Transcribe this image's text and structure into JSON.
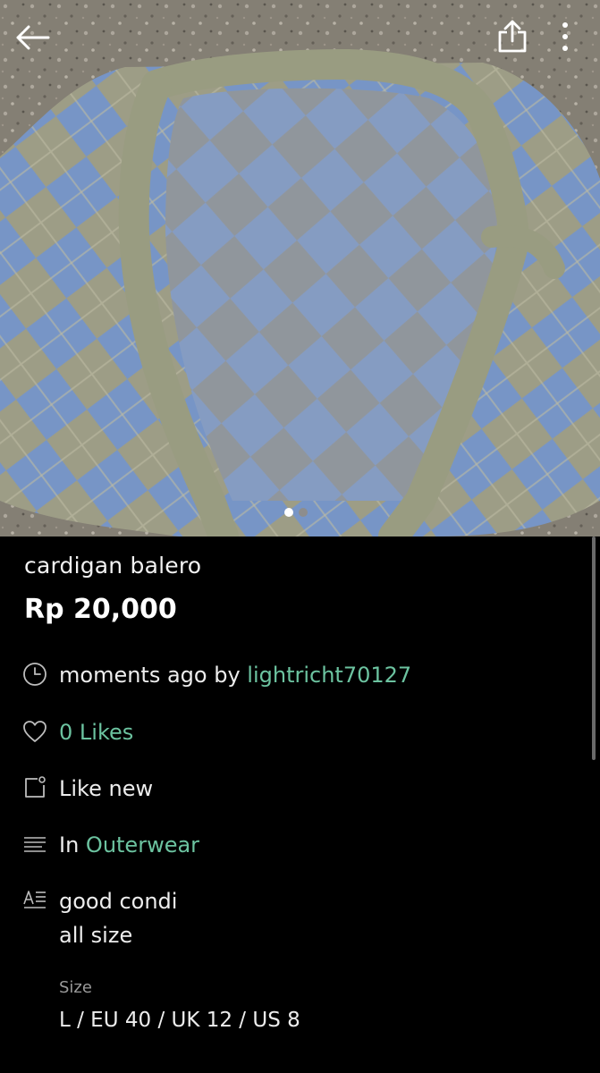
{
  "listing": {
    "title": "cardigan balero",
    "price": "Rp 20,000"
  },
  "meta": {
    "time_text": "moments ago by ",
    "seller": "lightricht70127",
    "likes": "0 Likes",
    "condition": "Like new",
    "category_prefix": "In ",
    "category": "Outerwear",
    "description_lines": [
      "good condi",
      "all size"
    ],
    "size_label": "Size",
    "size_value": "L / EU 40 / UK 12 / US 8"
  },
  "gallery": {
    "image_count": 2,
    "active_index": 0,
    "photo_subject": "cardigan-photo"
  },
  "icons": {
    "back": "arrow-left-icon",
    "share": "share-icon",
    "more": "more-vertical-icon",
    "time": "clock-icon",
    "likes": "heart-icon",
    "condition": "tag-icon",
    "category": "list-icon",
    "description": "text-icon"
  },
  "colors": {
    "background": "#000000",
    "accent": "#6cc3a0",
    "text": "#ededed",
    "muted": "#9a9a9a"
  }
}
